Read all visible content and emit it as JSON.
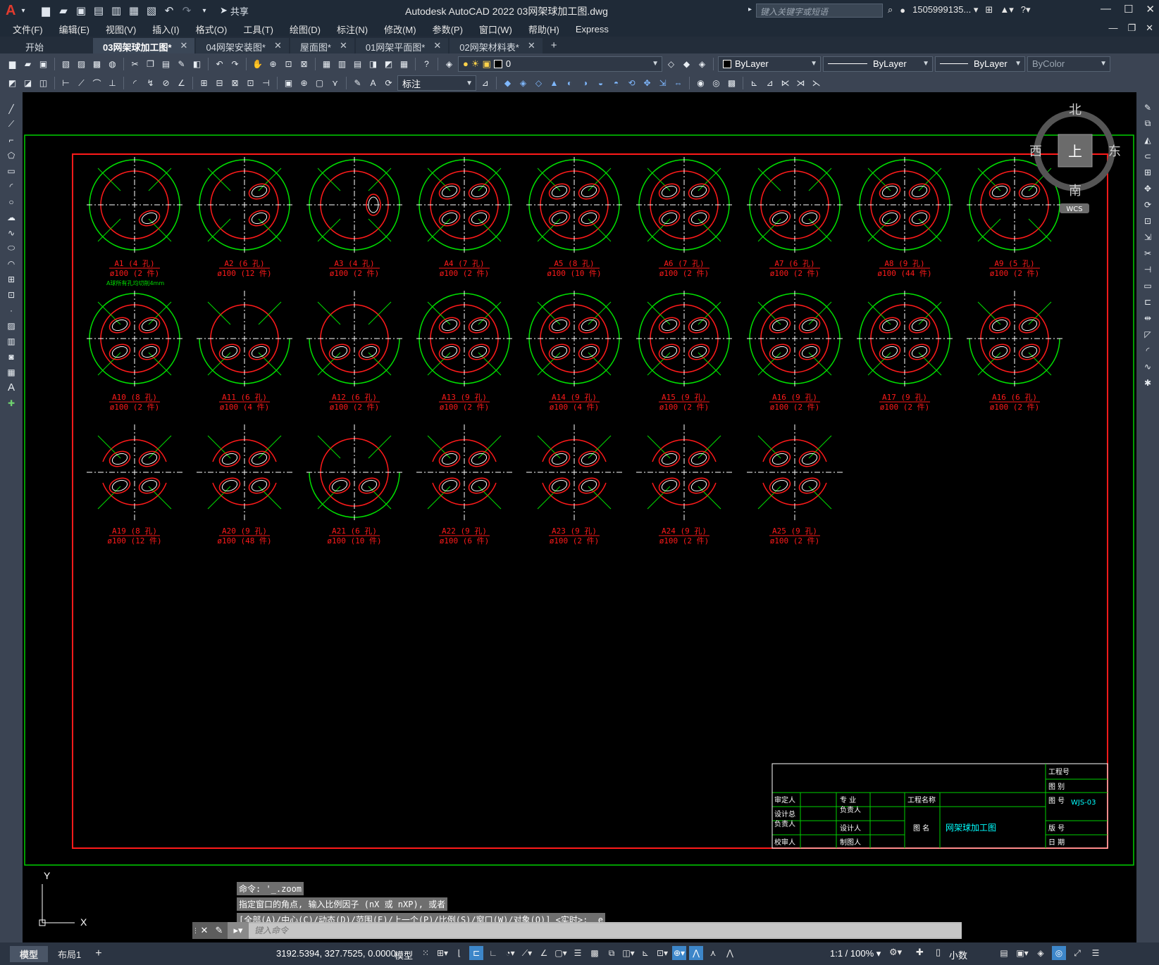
{
  "app": {
    "window_title": "Autodesk AutoCAD 2022    03网架球加工图.dwg",
    "share_label": "共享",
    "search_placeholder": "键入关键字或短语",
    "user": "1505999135... ▾"
  },
  "menu": [
    "文件(F)",
    "编辑(E)",
    "视图(V)",
    "插入(I)",
    "格式(O)",
    "工具(T)",
    "绘图(D)",
    "标注(N)",
    "修改(M)",
    "参数(P)",
    "窗口(W)",
    "帮助(H)",
    "Express"
  ],
  "tabs": [
    {
      "label": "开始",
      "active": false,
      "closable": false
    },
    {
      "label": "03网架球加工图*",
      "active": true,
      "closable": true
    },
    {
      "label": "04网架安装图*",
      "active": false,
      "closable": true
    },
    {
      "label": "屋面图*",
      "active": false,
      "closable": true
    },
    {
      "label": "01网架平面图*",
      "active": false,
      "closable": true
    },
    {
      "label": "02网架材料表*",
      "active": false,
      "closable": true
    }
  ],
  "toolbar": {
    "layer_value": "0",
    "color_value": "ByLayer",
    "linetype_value": "ByLayer",
    "lineweight_value": "ByLayer",
    "plotstyle_value": "ByColor",
    "dimstyle_value": "标注"
  },
  "viewcube": {
    "north": "北",
    "south": "南",
    "east": "东",
    "west": "西",
    "top": "上",
    "wcs": "WCS"
  },
  "balls": [
    {
      "name": "A1 (4 孔)",
      "spec": "ø100 (2 件)",
      "note": "A球所有孔均切削4mm",
      "type": "A"
    },
    {
      "name": "A2 (6 孔)",
      "spec": "ø100 (12 件)",
      "type": "B"
    },
    {
      "name": "A3 (4 孔)",
      "spec": "ø100 (2 件)",
      "type": "C"
    },
    {
      "name": "A4 (7 孔)",
      "spec": "ø100 (2 件)",
      "type": "D"
    },
    {
      "name": "A5 (8 孔)",
      "spec": "ø100 (10 件)",
      "type": "D"
    },
    {
      "name": "A6 (7 孔)",
      "spec": "ø100 (2 件)",
      "type": "D"
    },
    {
      "name": "A7 (6 孔)",
      "spec": "ø100 (2 件)",
      "type": "E"
    },
    {
      "name": "A8 (9 孔)",
      "spec": "ø100 (44 件)",
      "type": "D"
    },
    {
      "name": "A9 (5 孔)",
      "spec": "ø100 (2 件)",
      "type": "F"
    },
    {
      "name": "A10 (8 孔)",
      "spec": "ø100 (2 件)",
      "type": "D"
    },
    {
      "name": "A11 (6 孔)",
      "spec": "ø100 (4 件)",
      "type": "G"
    },
    {
      "name": "A12 (6 孔)",
      "spec": "ø100 (2 件)",
      "type": "G"
    },
    {
      "name": "A13 (9 孔)",
      "spec": "ø100 (2 件)",
      "type": "D"
    },
    {
      "name": "A14 (9 孔)",
      "spec": "ø100 (4 件)",
      "type": "D"
    },
    {
      "name": "A15 (9 孔)",
      "spec": "ø100 (2 件)",
      "type": "D"
    },
    {
      "name": "A16 (9 孔)",
      "spec": "ø100 (2 件)",
      "type": "D"
    },
    {
      "name": "A17 (9 孔)",
      "spec": "ø100 (2 件)",
      "type": "D"
    },
    {
      "name": "A16 (6 孔)",
      "spec": "ø100 (2 件)",
      "type": "H"
    },
    {
      "name": "A19 (8 孔)",
      "spec": "ø100 (12 件)",
      "type": "I"
    },
    {
      "name": "A20 (9 孔)",
      "spec": "ø100 (48 件)",
      "type": "I"
    },
    {
      "name": "A21 (6 孔)",
      "spec": "ø100 (10 件)",
      "type": "G"
    },
    {
      "name": "A22 (9 孔)",
      "spec": "ø100 (6 件)",
      "type": "I"
    },
    {
      "name": "A23 (9 孔)",
      "spec": "ø100 (2 件)",
      "type": "I"
    },
    {
      "name": "A24 (9 孔)",
      "spec": "ø100 (2 件)",
      "type": "I"
    },
    {
      "name": "A25 (9 孔)",
      "spec": "ø100 (2 件)",
      "type": "I"
    }
  ],
  "title_block": {
    "project_no": "工程号",
    "category": "图 别",
    "drawing_no_label": "图 号",
    "drawing_no": "WJS-03",
    "version": "版 号",
    "date": "日 期",
    "reviewer": "审定人",
    "discipline_lead_1": "专  业",
    "discipline_lead_2": "负责人",
    "project_name_label": "工程名称",
    "design_lead_1": "设计总",
    "design_lead_2": "负责人",
    "designer": "设计人",
    "drawing_name_label": "图 名",
    "drawing_name": "网架球加工图",
    "checker": "校审人",
    "drafter": "制图人"
  },
  "commands": {
    "history": [
      "命令: '_.zoom",
      "指定窗口的角点, 输入比例因子 (nX 或 nXP), 或者",
      "[全部(A)/中心(C)/动态(D)/范围(E)/上一个(P)/比例(S)/窗口(W)/对象(O)] <实时>: _e"
    ],
    "placeholder": "键入命令"
  },
  "status": {
    "layout_tabs": [
      "模型",
      "布局1"
    ],
    "coords": "3192.5394, 327.7525, 0.0000",
    "mode": "模型",
    "scale": "1:1 / 100% ▾",
    "units": "小数"
  }
}
